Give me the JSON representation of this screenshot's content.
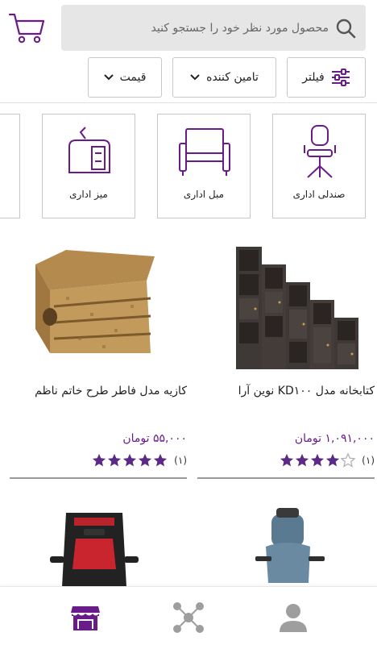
{
  "search": {
    "placeholder": "محصول مورد نظر خود را جستجو کنید"
  },
  "filters": {
    "filter_label": "فیلتر",
    "supplier_label": "تامین کننده",
    "price_label": "قیمت"
  },
  "categories": [
    {
      "label": "صندلی اداری",
      "icon": "office-chair-icon"
    },
    {
      "label": "مبل اداری",
      "icon": "office-sofa-icon"
    },
    {
      "label": "میز اداری",
      "icon": "office-desk-icon"
    },
    {
      "label": "",
      "icon": "partial-category"
    }
  ],
  "products": [
    {
      "title": "کتابخانه مدل KD۱۰۰ نوین آرا",
      "price": "۱,۰۹۱,۰۰۰ تومان",
      "rating": 4,
      "rating_count": "(۱)",
      "image": "bookshelf-image"
    },
    {
      "title": "کازیه مدل فاطر طرح خاتم ناظم",
      "price": "۵۵,۰۰۰ تومان",
      "rating": 5,
      "rating_count": "(۱)",
      "image": "cardboard-tray-image"
    },
    {
      "image": "mesh-office-chair-image"
    },
    {
      "image": "gaming-chair-image"
    }
  ],
  "colors": {
    "accent": "#6a1b8a",
    "star": "#5b2a86",
    "star_empty": "#b0b0b0",
    "nav_active": "#6a1b8a",
    "nav_inactive": "#9e9e9e"
  },
  "bottom_nav": [
    {
      "icon": "store-icon",
      "active": true
    },
    {
      "icon": "network-icon",
      "active": false
    },
    {
      "icon": "user-icon",
      "active": false
    }
  ]
}
